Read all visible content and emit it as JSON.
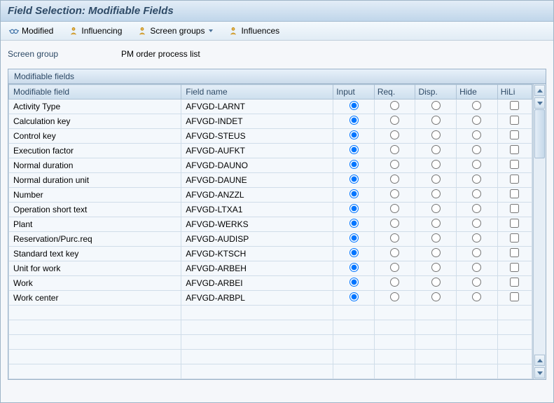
{
  "title": "Field Selection: Modifiable Fields",
  "toolbar": {
    "modified": "Modified",
    "influencing": "Influencing",
    "screen_groups": "Screen groups",
    "influences": "Influences"
  },
  "info": {
    "label": "Screen group",
    "value": "PM order process list"
  },
  "panel": {
    "title": "Modifiable fields",
    "headers": {
      "modifiable_field": "Modifiable field",
      "field_name": "Field name",
      "input": "Input",
      "req": "Req.",
      "disp": "Disp.",
      "hide": "Hide",
      "hili": "HiLi"
    },
    "rows": [
      {
        "mf": "Activity Type",
        "fn": "AFVGD-LARNT",
        "sel": "input"
      },
      {
        "mf": "Calculation key",
        "fn": "AFVGD-INDET",
        "sel": "input"
      },
      {
        "mf": "Control key",
        "fn": "AFVGD-STEUS",
        "sel": "input"
      },
      {
        "mf": "Execution factor",
        "fn": "AFVGD-AUFKT",
        "sel": "input"
      },
      {
        "mf": "Normal duration",
        "fn": "AFVGD-DAUNO",
        "sel": "input"
      },
      {
        "mf": "Normal duration unit",
        "fn": "AFVGD-DAUNE",
        "sel": "input"
      },
      {
        "mf": "Number",
        "fn": "AFVGD-ANZZL",
        "sel": "input"
      },
      {
        "mf": "Operation short text",
        "fn": "AFVGD-LTXA1",
        "sel": "input"
      },
      {
        "mf": "Plant",
        "fn": "AFVGD-WERKS",
        "sel": "input"
      },
      {
        "mf": "Reservation/Purc.req",
        "fn": "AFVGD-AUDISP",
        "sel": "input"
      },
      {
        "mf": "Standard text key",
        "fn": "AFVGD-KTSCH",
        "sel": "input"
      },
      {
        "mf": "Unit for work",
        "fn": "AFVGD-ARBEH",
        "sel": "input"
      },
      {
        "mf": "Work",
        "fn": "AFVGD-ARBEI",
        "sel": "input"
      },
      {
        "mf": "Work center",
        "fn": "AFVGD-ARBPL",
        "sel": "input"
      }
    ],
    "empty_rows": 5
  }
}
